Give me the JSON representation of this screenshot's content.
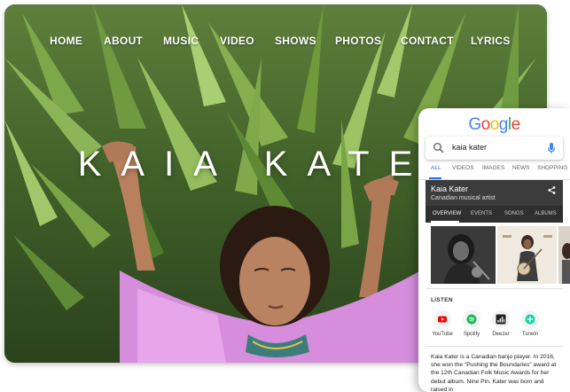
{
  "website": {
    "nav": [
      "HOME",
      "ABOUT",
      "MUSIC",
      "VIDEO",
      "SHOWS",
      "PHOTOS",
      "CONTACT",
      "LYRICS"
    ],
    "hero_title": "KAIA KATE"
  },
  "google": {
    "logo_letters": [
      {
        "ch": "G",
        "color": "#4285F4"
      },
      {
        "ch": "o",
        "color": "#EA4335"
      },
      {
        "ch": "o",
        "color": "#FBBC05"
      },
      {
        "ch": "g",
        "color": "#4285F4"
      },
      {
        "ch": "l",
        "color": "#34A853"
      },
      {
        "ch": "e",
        "color": "#EA4335"
      }
    ],
    "search_query": "kaia kater",
    "tabs": [
      "ALL",
      "VIDEOS",
      "IMAGES",
      "NEWS",
      "SHOPPING"
    ],
    "active_tab": "ALL",
    "knowledge_panel": {
      "name": "Kaia Kater",
      "description": "Canadian musical artist",
      "tabs": [
        "OVERVIEW",
        "EVENTS",
        "SONGS",
        "ALBUMS"
      ],
      "active_tab": "OVERVIEW"
    },
    "listen": {
      "label": "LISTEN",
      "services": [
        {
          "name": "YouTube",
          "icon": "youtube-icon",
          "color": "#FF0000"
        },
        {
          "name": "Spotify",
          "icon": "spotify-icon",
          "color": "#1DB954"
        },
        {
          "name": "Deezer",
          "icon": "deezer-icon",
          "color": "#222222"
        },
        {
          "name": "TuneIn",
          "icon": "tunein-icon",
          "color": "#14D8A0"
        }
      ]
    },
    "description": "Kaia Kater is a Canadian banjo player. In 2016, she won the \"Pushing the Boundaries\" award at the 12th Canadian Folk Music Awards for her debut album. Nine Pin. Kater was born and raised in"
  }
}
